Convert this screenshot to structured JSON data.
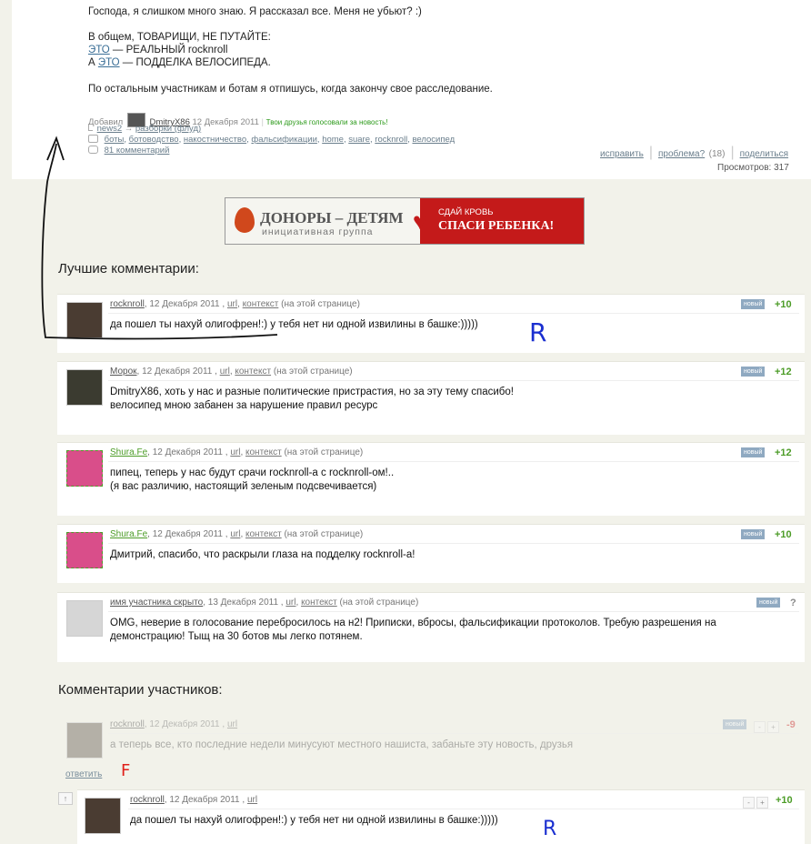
{
  "post": {
    "paragraph1": "Господа, я слишком много знаю. Я рассказал все. Меня не убьют? :)",
    "line_general": "В общем, ТОВАРИЩИ, НЕ ПУТАЙТЕ:",
    "line2_link": "ЭТО",
    "line2_text": " — РЕАЛЬНЫЙ rocknroll",
    "line3_prefix": "А ",
    "line3_link": "ЭТО",
    "line3_text": " — ПОДДЕЛКА ВЕЛОСИПЕДА.",
    "paragraph_last": "По остальным участникам и ботам я отпишусь, когда закончу свое расследование.",
    "added_label": "Добавил",
    "author": "DmitryX86",
    "date": "12 Декабря 2011",
    "friends_voted": "Твои друзья голосовали за новость!",
    "crumb1": "news2",
    "crumb_arrow": "→",
    "crumb2": "разборки (флуд)",
    "tags": [
      "боты",
      "ботоводство",
      "накостничество",
      "фальсификации",
      "home",
      "suare",
      "rocknroll",
      "велосипед"
    ],
    "comments_link": "81 комментарий",
    "edit": "исправить",
    "problem": "проблема?",
    "problem_count": "(18)",
    "share": "поделиться",
    "views": "Просмотров: 317"
  },
  "banner": {
    "left": "ДОНОРЫ – ДЕТЯМ",
    "left_sub": "инициативная группа",
    "right_top": "СДАЙ КРОВЬ",
    "right_main": "СПАСИ РЕБЕНКА!"
  },
  "best_title": "Лучшие комментарии:",
  "member_title": "Комментарии участников:",
  "common": {
    "url": "url",
    "context": "контекст",
    "on_page": "(на этой странице)",
    "new": "новый",
    "reply": "ответить"
  },
  "best": [
    {
      "author": "rocknroll",
      "date": ", 12 Декабря 2011 ,",
      "score": "+10",
      "text1": "да пошел ты нахуй олигофрен!:) у тебя нет ни одной извилины в башке:)))))",
      "text2": ""
    },
    {
      "author": "Морок",
      "date": ", 12 Декабря 2011 ,",
      "score": "+12",
      "text1": "DmitryX86, хоть у нас и разные политические пристрастия, но за эту тему спасибо!",
      "text2": "велосипед мною забанен за нарушение правил ресурс"
    },
    {
      "author": "Shura.Fe",
      "date": ", 12 Декабря 2011 ,",
      "score": "+12",
      "text1": "пипец, теперь у нас будут срачи rocknroll-а с rocknroll-ом!..",
      "text2": "(я вас различию, настоящий зеленым подсвечивается)"
    },
    {
      "author": "Shura.Fe",
      "date": ", 12 Декабря 2011 ,",
      "score": "+10",
      "text1": "Дмитрий, спасибо, что раскрыли глаза на подделку rocknroll-а!",
      "text2": ""
    },
    {
      "author": "имя участника скрыто",
      "date": ", 13 Декабря 2011 ,",
      "score": "?",
      "text1": "OMG, неверие в голосование перебросилось на н2! Приписки, вбросы, фальсификации протоколов. Требую разрешения на",
      "text2": "демонстрацию! Тыщ на 30 ботов мы легко потянем."
    }
  ],
  "members": [
    {
      "author": "rocknroll",
      "date": ", 12 Декабря 2011 ,",
      "score": "-9",
      "text": "а теперь все, кто последние недели минусуют местного нашиста, забаньте эту новость, друзья"
    },
    {
      "author": "rocknroll",
      "date": ", 12 Декабря 2011 ,",
      "score": "+10",
      "text": "да пошел ты нахуй олигофрен!:) у тебя нет ни одной извилины в башке:)))))"
    }
  ],
  "vote_minus": "-",
  "vote_plus": "+",
  "up_arrow": "↑",
  "annotations": {
    "r1": "R",
    "f": "F",
    "r2": "R"
  },
  "colors": {
    "accent_green": "#2c9a1a",
    "badge": "#8fa9c1",
    "banner_red": "#c41a1a",
    "ink_blue": "#1a2fd0",
    "ink_red": "#e0201a"
  }
}
